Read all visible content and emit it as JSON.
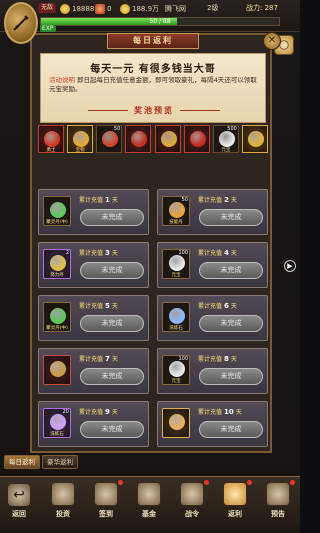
{
  "status": {
    "name": "无敌",
    "coins": "18888",
    "gems": "0",
    "silver": "188.9万",
    "player": "腾飞网",
    "level": "2级",
    "power": "战力: 287",
    "exp_text": "50 / 88",
    "exp_fraction": 0.57,
    "exp_tag": "EXP"
  },
  "panel": {
    "title": "每日返利",
    "close": "✕",
    "headline": "每天一元 有很多钱当大哥",
    "desc_label": "活动说明",
    "desc": "即日起每日充值任意金额，即可领取豪礼，每隔4天还可以领取元宝奖励。",
    "pool_title": "奖池预览"
  },
  "pool": [
    {
      "name": "勇士",
      "count": "",
      "style": "red",
      "color": "#d23a22"
    },
    {
      "name": "宝物",
      "count": "",
      "style": "gold",
      "color": "#e3a93a"
    },
    {
      "name": "",
      "count": "50",
      "style": "",
      "color": "#d2442a"
    },
    {
      "name": "",
      "count": "",
      "style": "red",
      "color": "#c43222"
    },
    {
      "name": "",
      "count": "",
      "style": "red",
      "color": "#d9a83a"
    },
    {
      "name": "",
      "count": "",
      "style": "red",
      "color": "#c82a22"
    },
    {
      "name": "元宝",
      "count": "500",
      "style": "",
      "color": "#e8e8e8"
    },
    {
      "name": "",
      "count": "",
      "style": "gold",
      "color": "#e0b23a"
    }
  ],
  "days": [
    {
      "label": "累计充值",
      "day": "1",
      "unit": "天",
      "btn": "未完成",
      "item": "聚灵丹(中)",
      "qty": "",
      "slot": "",
      "color": "#5ac85a"
    },
    {
      "label": "累计充值",
      "day": "2",
      "unit": "天",
      "btn": "未完成",
      "item": "技能丹",
      "qty": "50",
      "slot": "",
      "color": "#e8a23a"
    },
    {
      "label": "累计充值",
      "day": "3",
      "unit": "天",
      "btn": "未完成",
      "item": "努力丹",
      "qty": "2",
      "slot": "purple",
      "color": "#e0c040"
    },
    {
      "label": "累计充值",
      "day": "4",
      "unit": "天",
      "btn": "未完成",
      "item": "元宝",
      "qty": "100",
      "slot": "",
      "color": "#e8e8e8"
    },
    {
      "label": "累计充值",
      "day": "5",
      "unit": "天",
      "btn": "未完成",
      "item": "聚灵丹(中)",
      "qty": "",
      "slot": "",
      "color": "#5ac85a"
    },
    {
      "label": "累计充值",
      "day": "6",
      "unit": "天",
      "btn": "未完成",
      "item": "洗炼石",
      "qty": "",
      "slot": "",
      "color": "#8ab8ff"
    },
    {
      "label": "累计充值",
      "day": "7",
      "unit": "天",
      "btn": "未完成",
      "item": "",
      "qty": "",
      "slot": "red",
      "color": "#c8a040"
    },
    {
      "label": "累计充值",
      "day": "8",
      "unit": "天",
      "btn": "未完成",
      "item": "元宝",
      "qty": "100",
      "slot": "",
      "color": "#e8e8e8"
    },
    {
      "label": "累计充值",
      "day": "9",
      "unit": "天",
      "btn": "未完成",
      "item": "洗练石",
      "qty": "20",
      "slot": "purple",
      "color": "#d0a0ff"
    },
    {
      "label": "累计充值",
      "day": "10",
      "unit": "天",
      "btn": "未完成",
      "item": "",
      "qty": "",
      "slot": "gold",
      "color": "#e8b060"
    }
  ],
  "tabs": [
    {
      "label": "每日返利",
      "active": true
    },
    {
      "label": "豪华返利",
      "active": false
    }
  ],
  "back_label": "返回",
  "nav": [
    {
      "label": "投资",
      "dot": false
    },
    {
      "label": "签到",
      "dot": true
    },
    {
      "label": "基金",
      "dot": false
    },
    {
      "label": "战令",
      "dot": true
    },
    {
      "label": "返利",
      "dot": true,
      "active": true
    },
    {
      "label": "预告",
      "dot": true
    }
  ],
  "side_play": "▶"
}
